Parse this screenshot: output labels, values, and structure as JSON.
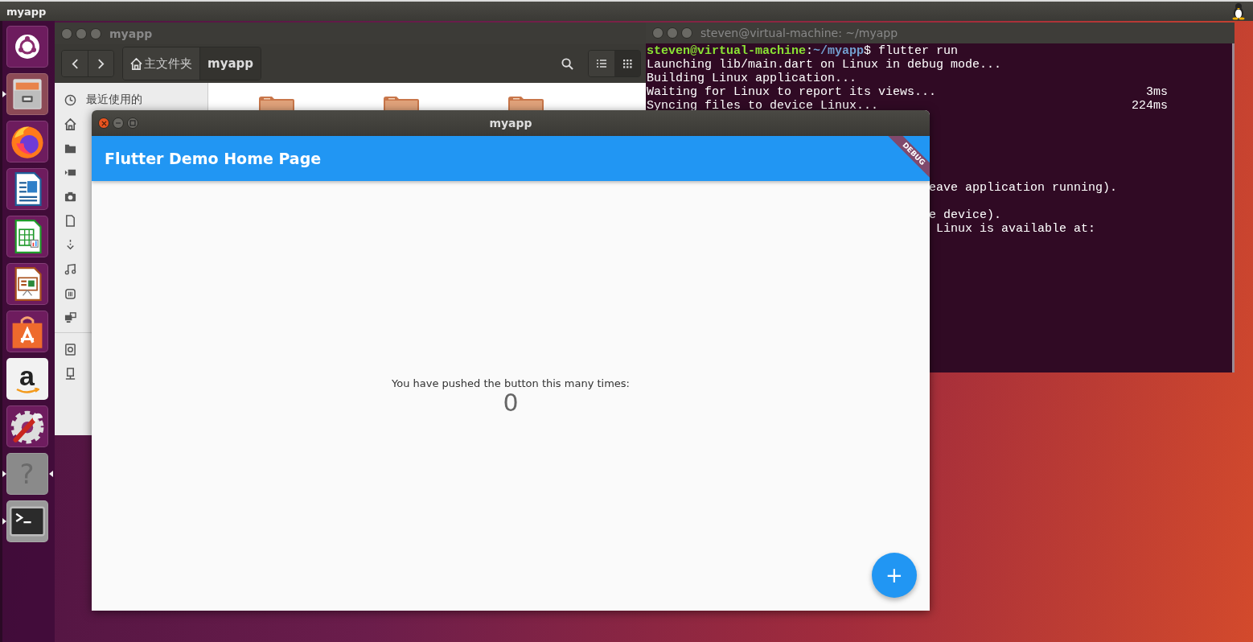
{
  "top_bar": {
    "title": "myapp"
  },
  "launcher": [
    {
      "kind": "dash",
      "running": false,
      "focused": false
    },
    {
      "kind": "files",
      "running": true,
      "focused": false
    },
    {
      "kind": "browser",
      "running": false,
      "focused": false
    },
    {
      "kind": "writer",
      "running": false,
      "focused": false
    },
    {
      "kind": "calc",
      "running": false,
      "focused": false
    },
    {
      "kind": "impress",
      "running": false,
      "focused": false
    },
    {
      "kind": "software",
      "running": false,
      "focused": false
    },
    {
      "kind": "amazon",
      "glyph": "a",
      "running": false,
      "focused": false
    },
    {
      "kind": "settings",
      "running": false,
      "focused": false
    },
    {
      "kind": "help",
      "glyph": "?",
      "running": true,
      "focused": true
    },
    {
      "kind": "terminal",
      "running": true,
      "focused": false
    }
  ],
  "file_manager": {
    "title": "myapp",
    "focused": false,
    "path": [
      {
        "kind": "home",
        "label": "主文件夹",
        "selected": false
      },
      {
        "kind": "folder",
        "label": "myapp",
        "selected": true
      }
    ],
    "view_buttons": [
      {
        "kind": "list",
        "selected": false
      },
      {
        "kind": "grid",
        "selected": true
      }
    ],
    "sidebar": {
      "places": [
        {
          "kind": "recent",
          "label": "最近使用的"
        },
        {
          "kind": "home"
        },
        {
          "kind": "desktop"
        },
        {
          "kind": "videos"
        },
        {
          "kind": "pictures"
        },
        {
          "kind": "documents"
        },
        {
          "kind": "downloads"
        },
        {
          "kind": "music"
        },
        {
          "kind": "trash"
        },
        {
          "kind": "network"
        }
      ],
      "devices": [
        {
          "kind": "computer"
        },
        {
          "kind": "connect"
        }
      ]
    }
  },
  "terminal": {
    "title": "steven@virtual-machine: ~/myapp",
    "focused": false,
    "prompt": {
      "user": "steven@virtual-machine",
      "separator": ":",
      "path": "~/myapp",
      "command": "$ flutter run"
    },
    "lines": [
      {
        "kind": "full",
        "text": "Launching lib/main.dart on Linux in debug mode..."
      },
      {
        "kind": "full",
        "text": "Building Linux application..."
      },
      {
        "kind": "full",
        "text": "Waiting for Linux to report its views...",
        "time": "3ms"
      },
      {
        "kind": "full",
        "text": "Syncing files to device Linux...",
        "time": "224ms"
      },
      {
        "kind": "covered"
      },
      {
        "kind": "covered"
      },
      {
        "kind": "covered"
      },
      {
        "kind": "covered"
      },
      {
        "kind": "covered"
      },
      {
        "kind": "tail",
        "text": "eave application running)."
      },
      {
        "kind": "covered"
      },
      {
        "kind": "tail",
        "text": "e device)."
      },
      {
        "kind": "tail",
        "text": " Linux is available at:"
      }
    ]
  },
  "flutter_window": {
    "title": "myapp",
    "focused": true,
    "app_bar_title": "Flutter Demo Home Page",
    "banner": "DEBUG",
    "message": "You have pushed the button this many times:",
    "counter": "0",
    "fab": "+"
  }
}
